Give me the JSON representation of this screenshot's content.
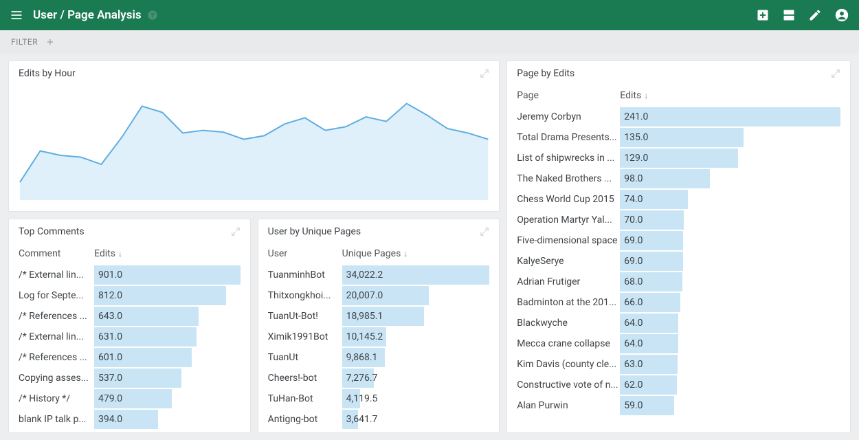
{
  "topbar": {
    "title": "User / Page Analysis"
  },
  "filterbar": {
    "label": "FILTER"
  },
  "panels": {
    "edits_by_hour": {
      "title": "Edits by Hour"
    },
    "top_comments": {
      "title": "Top Comments",
      "col_label": "Comment",
      "col_value": "Edits"
    },
    "user_unique": {
      "title": "User by Unique Pages",
      "col_label": "User",
      "col_value": "Unique Pages"
    },
    "page_by_edits": {
      "title": "Page by Edits",
      "col_label": "Page",
      "col_value": "Edits"
    }
  },
  "chart_data": {
    "type": "area",
    "title": "Edits by Hour",
    "xlabel": "",
    "ylabel": "",
    "x": [
      0,
      1,
      2,
      3,
      4,
      5,
      6,
      7,
      8,
      9,
      10,
      11,
      12,
      13,
      14,
      15,
      16,
      17,
      18,
      19,
      20,
      21,
      22,
      23
    ],
    "values": [
      20,
      55,
      50,
      48,
      40,
      70,
      105,
      98,
      75,
      78,
      76,
      68,
      72,
      85,
      92,
      78,
      82,
      93,
      88,
      108,
      95,
      80,
      75,
      68
    ],
    "ylim": [
      0,
      120
    ],
    "colors": {
      "stroke": "#5dade2",
      "fill": "#dff0fa"
    }
  },
  "top_comments": {
    "max": 901.0,
    "rows": [
      {
        "label": "/* External lin...",
        "value": 901.0
      },
      {
        "label": "Log for Septe...",
        "value": 812.0
      },
      {
        "label": "/* References ...",
        "value": 643.0
      },
      {
        "label": "/* External lin...",
        "value": 631.0
      },
      {
        "label": "/* References ...",
        "value": 601.0
      },
      {
        "label": "Copying asses...",
        "value": 537.0
      },
      {
        "label": "/* History */",
        "value": 479.0
      },
      {
        "label": "blank IP talk p...",
        "value": 394.0
      }
    ]
  },
  "user_unique": {
    "max": 34022.2,
    "rows": [
      {
        "label": "TuanminhBot",
        "value": 34022.2,
        "display": "34,022.2"
      },
      {
        "label": "Thitxongkhoi...",
        "value": 20007.0,
        "display": "20,007.0"
      },
      {
        "label": "TuanUt-Bot!",
        "value": 18985.1,
        "display": "18,985.1"
      },
      {
        "label": "Ximik1991Bot",
        "value": 10145.2,
        "display": "10,145.2"
      },
      {
        "label": "TuanUt",
        "value": 9868.1,
        "display": "9,868.1"
      },
      {
        "label": "Cheers!-bot",
        "value": 7276.7,
        "display": "7,276.7"
      },
      {
        "label": "TuHan-Bot",
        "value": 4119.5,
        "display": "4,119.5"
      },
      {
        "label": "Antigng-bot",
        "value": 3641.7,
        "display": "3,641.7"
      }
    ]
  },
  "page_by_edits": {
    "max": 241.0,
    "rows": [
      {
        "label": "Jeremy Corbyn",
        "value": 241.0
      },
      {
        "label": "Total Drama Presents...",
        "value": 135.0
      },
      {
        "label": "List of shipwrecks in ...",
        "value": 129.0
      },
      {
        "label": "The Naked Brothers ...",
        "value": 98.0
      },
      {
        "label": "Chess World Cup 2015",
        "value": 74.0
      },
      {
        "label": "Operation Martyr Yal...",
        "value": 70.0
      },
      {
        "label": "Five-dimensional space",
        "value": 69.0
      },
      {
        "label": "KalyeSerye",
        "value": 69.0
      },
      {
        "label": "Adrian Frutiger",
        "value": 68.0
      },
      {
        "label": "Badminton at the 201...",
        "value": 66.0
      },
      {
        "label": "Blackwyche",
        "value": 64.0
      },
      {
        "label": "Mecca crane collapse",
        "value": 64.0
      },
      {
        "label": "Kim Davis (county cle...",
        "value": 63.0
      },
      {
        "label": "Constructive vote of n...",
        "value": 62.0
      },
      {
        "label": "Alan Purwin",
        "value": 59.0
      }
    ]
  }
}
